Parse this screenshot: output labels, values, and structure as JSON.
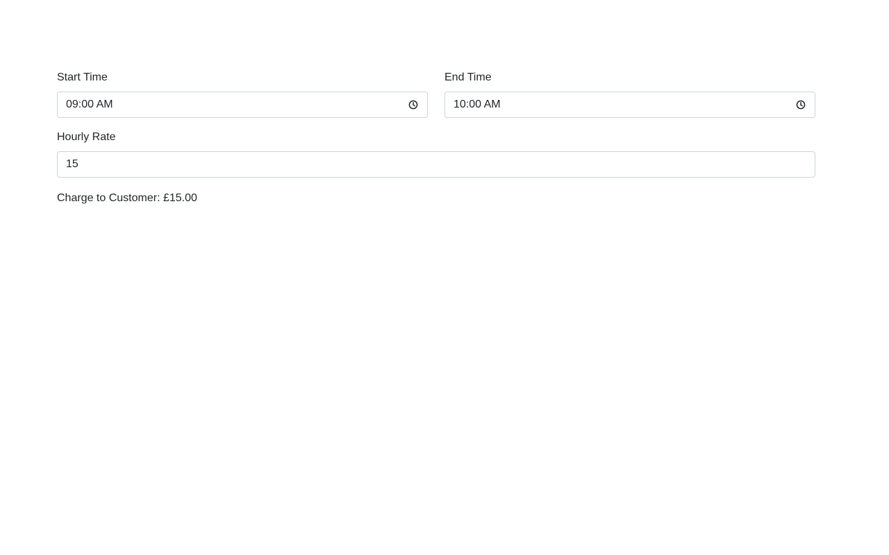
{
  "start_time": {
    "label": "Start Time",
    "value": "09:00 AM",
    "icon": "clock-icon"
  },
  "end_time": {
    "label": "End Time",
    "value": "10:00 AM",
    "icon": "clock-icon"
  },
  "hourly_rate": {
    "label": "Hourly Rate",
    "value": "15"
  },
  "charge": {
    "text": "Charge to Customer: £15.00"
  }
}
